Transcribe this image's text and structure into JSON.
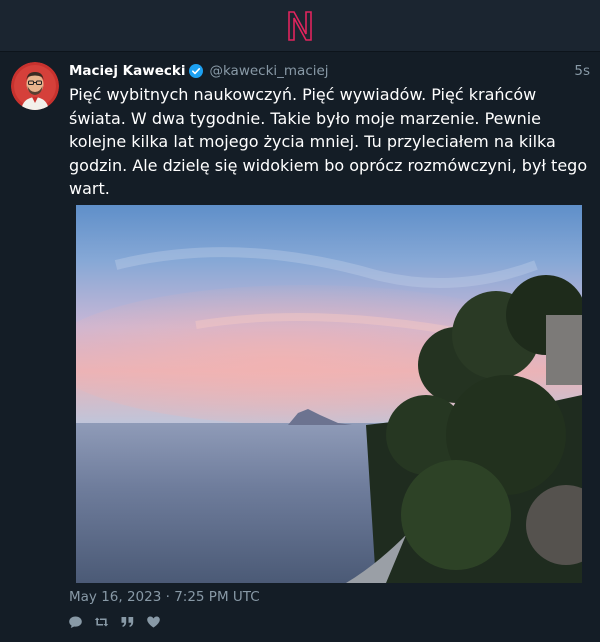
{
  "app": {
    "logo_icon": "n-logo-icon",
    "accent": "#e0245e"
  },
  "tweet": {
    "author_name": "Maciej Kawecki",
    "verified": true,
    "handle": "@kawecki_maciej",
    "relative_time": "5s",
    "text": "Pięć wybitnych naukowczyń. Pięć wywiadów. Pięć krańców świata. W dwa tygodnie. Takie było moje marzenie. Pewnie kolejne kilka lat mojego życia mniej. Tu przyleciałem na kilka godzin. Ale dzielę się widokiem bo oprócz rozmówczyni, był tego wart.",
    "media_description_icon": "sunset-sea-photo",
    "timestamp": "May 16, 2023 · 7:25 PM UTC",
    "actions": [
      "reply-icon",
      "retweet-icon",
      "quote-icon",
      "like-icon"
    ]
  }
}
